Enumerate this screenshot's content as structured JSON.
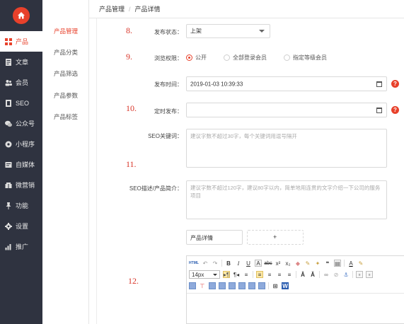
{
  "nav": {
    "items": [
      {
        "label": "产品",
        "icon": "grid-icon"
      },
      {
        "label": "文章",
        "icon": "document-icon"
      },
      {
        "label": "会员",
        "icon": "users-icon"
      },
      {
        "label": "SEO",
        "icon": "seo-icon"
      },
      {
        "label": "公众号",
        "icon": "wechat-icon"
      },
      {
        "label": "小程序",
        "icon": "miniprogram-icon"
      },
      {
        "label": "自媒体",
        "icon": "media-icon"
      },
      {
        "label": "微营销",
        "icon": "marketing-icon"
      },
      {
        "label": "功能",
        "icon": "pin-icon"
      },
      {
        "label": "设置",
        "icon": "gear-icon"
      },
      {
        "label": "推广",
        "icon": "chart-icon"
      }
    ]
  },
  "subnav": {
    "items": [
      "产品管理",
      "产品分类",
      "产品筛选",
      "产品参数",
      "产品标签"
    ]
  },
  "breadcrumb": {
    "parent": "产品管理",
    "separator": "/",
    "current": "产品详情"
  },
  "annotations": {
    "n8": "8.",
    "n9": "9.",
    "n10": "10.",
    "n11": "11.",
    "n12": "12."
  },
  "form": {
    "status_label": "发布状态：",
    "status_value": "上架",
    "access_label": "浏览权限：",
    "access_options": [
      "公开",
      "全部登录会员",
      "指定等级会员"
    ],
    "publish_time_label": "发布时间：",
    "publish_time_value": "2019-01-03 10:39:33",
    "scheduled_label": "定时发布：",
    "scheduled_value": "",
    "seo_keywords_label": "SEO关键词：",
    "seo_keywords_placeholder": "建议字数不超过30字，每个关键词用逗号隔开",
    "seo_desc_label": "SEO描述/产品简介：",
    "seo_desc_placeholder": "建议字数不超过120字，建议80字以内，简单地用连贯的文字介绍一下公司的服务项目",
    "help_glyph": "?"
  },
  "tabs": {
    "detail_tab": "产品详情",
    "add_tab": "+"
  },
  "editor": {
    "font_size": "14px",
    "html_label": "HTML"
  },
  "colors": {
    "accent": "#e8412b",
    "nav_bg": "#2f3340"
  }
}
